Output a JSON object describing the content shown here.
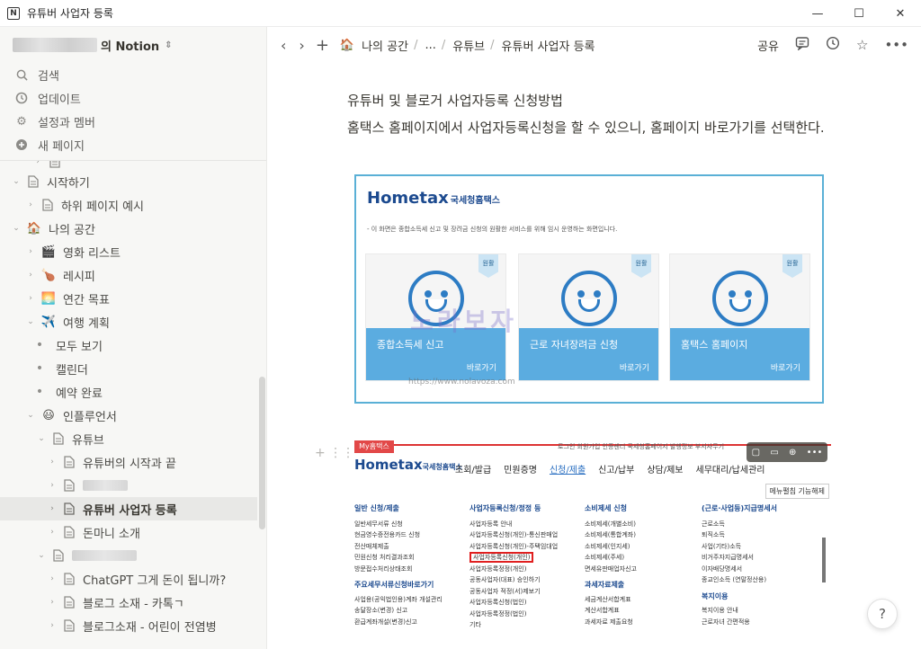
{
  "window": {
    "title": "유튜버 사업자 등록",
    "icon": "notion-app-icon",
    "controls": [
      "minimize",
      "maximize",
      "close"
    ]
  },
  "sidebar": {
    "workspace_suffix": "의 Notion",
    "menu": [
      {
        "label": "검색",
        "icon": "search-icon"
      },
      {
        "label": "업데이트",
        "icon": "clock-icon"
      },
      {
        "label": "설정과 멤버",
        "icon": "gear-icon"
      },
      {
        "label": "새 페이지",
        "icon": "plus-circle-icon"
      }
    ],
    "tree": [
      {
        "label": "시작하기",
        "depth": 1,
        "expanded": true,
        "type": "page"
      },
      {
        "label": "하위 페이지 예시",
        "depth": 2,
        "expanded": false,
        "type": "page"
      },
      {
        "label": "나의 공간",
        "depth": 1,
        "expanded": true,
        "type": "emoji",
        "emoji": "🏠"
      },
      {
        "label": "영화 리스트",
        "depth": 2,
        "expanded": false,
        "type": "emoji",
        "emoji": "🎬"
      },
      {
        "label": "레시피",
        "depth": 2,
        "expanded": false,
        "type": "emoji",
        "emoji": "🍗"
      },
      {
        "label": "연간 목표",
        "depth": 2,
        "expanded": false,
        "type": "emoji",
        "emoji": "🌅"
      },
      {
        "label": "여행 계획",
        "depth": 2,
        "expanded": true,
        "type": "emoji",
        "emoji": "✈️"
      },
      {
        "label": "모두 보기",
        "depth": 3,
        "type": "dot"
      },
      {
        "label": "캘린더",
        "depth": 3,
        "type": "dot"
      },
      {
        "label": "예약 완료",
        "depth": 3,
        "type": "dot"
      },
      {
        "label": "인플루언서",
        "depth": 2,
        "expanded": true,
        "type": "emoji",
        "emoji": "😃"
      },
      {
        "label": "유튜브",
        "depth": 3,
        "expanded": true,
        "type": "page"
      },
      {
        "label": "유튜버의 시작과 끝",
        "depth": 4,
        "expanded": false,
        "type": "page"
      },
      {
        "label": "",
        "depth": 4,
        "expanded": false,
        "type": "page",
        "blurred": true
      },
      {
        "label": "유튜버 사업자 등록",
        "depth": 4,
        "expanded": false,
        "type": "page",
        "selected": true
      },
      {
        "label": "돈마니 소개",
        "depth": 4,
        "expanded": false,
        "type": "page"
      },
      {
        "label": "",
        "depth": 3,
        "expanded": true,
        "type": "page",
        "blurred": true
      },
      {
        "label": "ChatGPT 그게 돈이 됩니까?",
        "depth": 4,
        "expanded": false,
        "type": "page"
      },
      {
        "label": "블로그 소재 - 카톡ㄱ",
        "depth": 4,
        "expanded": false,
        "type": "page"
      },
      {
        "label": "블로그소재 - 어린이 전염병",
        "depth": 4,
        "expanded": false,
        "type": "page"
      }
    ]
  },
  "topbar": {
    "breadcrumb": [
      "나의 공간",
      "...",
      "유튜브",
      "유튜버 사업자 등록"
    ],
    "share_label": "공유"
  },
  "content": {
    "heading_line": "유튜버 및 블로거 사업자등록 신청방법",
    "body_line": "홈택스 홈페이지에서 사업자등록신청을 할 수 있으니, 홈페이지 바로가기를 선택한다.",
    "image1": {
      "brand": "Hometax",
      "brand_sub": "국세청홈택스",
      "notice": "- 이 화면은 종합소득세 신고 및 장려금 신청의 원활한 서비스를 위해 임시 운영하는 화면입니다.",
      "cards": [
        {
          "title": "종합소득세 신고",
          "flag": "원활",
          "button": "바로가기"
        },
        {
          "title": "근로 자녀장려금 신청",
          "flag": "원활",
          "button": "바로가기"
        },
        {
          "title": "홈택스 홈페이지",
          "flag": "원활",
          "button": "바로가기"
        }
      ],
      "watermark": "노라보자",
      "watermark_url": "https://www.nolavoza.com"
    },
    "image2": {
      "tag": "My홈택스",
      "top_links": "로그인  회원가입  인증센터  국세청홈페이지  발행정보  부서사무기",
      "brand": "Hometax",
      "brand_sub": "국세청홈택스",
      "nav": [
        "조회/발급",
        "민원증명",
        "신청/제출",
        "신고/납부",
        "상담/제보",
        "세무대리/납세관리"
      ],
      "menu_button": "메뉴펼침 기능해제",
      "col1_title": "일반 신청/제출",
      "col1_items": [
        "일반세무서류 신청",
        "현금영수증전용카드 신청",
        "전산매체제출",
        "민원신청 처리결과조회",
        "방문접수처리상태조회"
      ],
      "col1_title2": "주요세무서류신청바로가기",
      "col1_items2": [
        "사업용(공익법인용)계좌 개설관리",
        "송달장소(변경) 신고",
        "환급계좌개설(변경)신고"
      ],
      "col2_title": "사업자등록신청/정정 등",
      "col2_items": [
        "사업자등록 안내",
        "사업자등록신청(개인)-통신판매업",
        "사업자등록신청(개인)-주택임대업",
        "사업자등록신청(개인)",
        "사업자등록정정(개인)",
        "공동사업자(대표) 승인하기",
        "공동사업자 적정(서)제보기",
        "사업자등록신청(법인)",
        "사업자등록정정(법인)",
        "기타"
      ],
      "col3_title": "소비제세 신청",
      "col3_items": [
        "소비제세(개별소비)",
        "소비제세(통합계좌)",
        "소비제세(인지세)",
        "소비제세(주세)",
        "면세유판매업자신고"
      ],
      "col3_title2": "과세자료제출",
      "col3_items2": [
        "세금계산서합계표",
        "계산서합계표",
        "과세자료 제출요청"
      ],
      "col4_title": "(근로·사업등)지급명세서",
      "col4_items": [
        "근로소득",
        "퇴직소득",
        "사업(기타)소득",
        "비거주자지급명세서",
        "이자배당명세서",
        "종교인소득 (연말정산용)"
      ],
      "col4_title2": "복지이용",
      "col4_items2": [
        "복지이용 안내",
        "근로자녀 간편적용"
      ]
    }
  },
  "help_label": "?"
}
